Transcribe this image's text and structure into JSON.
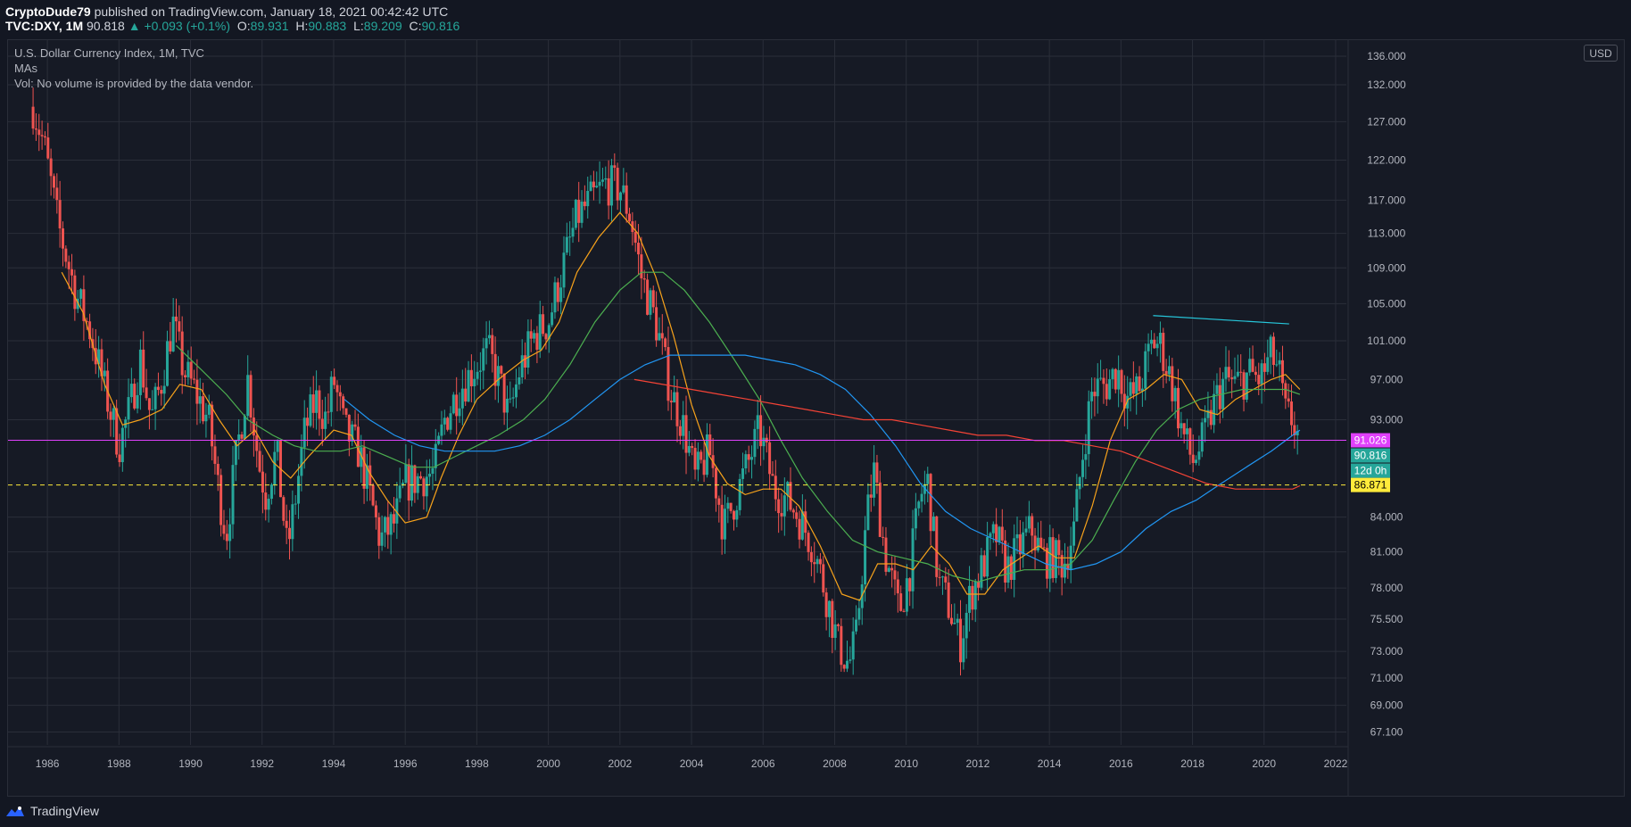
{
  "header": {
    "author": "CryptoDude79",
    "published_text": "published on TradingView.com, January 18, 2021 00:42:42 UTC",
    "symbol": "TVC:DXY, 1M",
    "last": "90.818",
    "change": "▲ +0.093 (+0.1%)",
    "o_label": "O:",
    "o": "89.931",
    "h_label": "H:",
    "h": "90.883",
    "l_label": "L:",
    "l": "89.209",
    "c_label": "C:",
    "c": "90.816"
  },
  "legend": {
    "title": "U.S. Dollar Currency Index, 1M, TVC",
    "mas": "MAs",
    "vol": "Vol: No volume is provided by the data vendor."
  },
  "currency_badge": "USD",
  "footer": {
    "brand": "TradingView"
  },
  "colors": {
    "background": "#161a25",
    "grid": "#2a2e39",
    "up_candle": "#26a69a",
    "down_candle": "#ef5350",
    "ma_orange": "#f7a21b",
    "ma_green": "#4caf50",
    "ma_blue": "#2196f3",
    "ma_red": "#f44336",
    "trendline": "#26c6da",
    "h_line_magenta": "#e040fb",
    "h_line_yellow": "#ffeb3b"
  },
  "chart_data": {
    "type": "candlestick",
    "title": "U.S. Dollar Currency Index, 1M, TVC",
    "currency": "USD",
    "x_ticks": [
      1986,
      1988,
      1990,
      1992,
      1994,
      1996,
      1998,
      2000,
      2002,
      2004,
      2006,
      2008,
      2010,
      2012,
      2014,
      2016,
      2018,
      2020,
      2022
    ],
    "y_ticks": [
      "136.000",
      "132.000",
      "127.000",
      "122.000",
      "117.000",
      "113.000",
      "109.000",
      "105.000",
      "101.000",
      "97.000",
      "93.000",
      "84.000",
      "81.000",
      "78.000",
      "75.500",
      "73.000",
      "71.000",
      "69.000",
      "67.100"
    ],
    "xlim": [
      1984.9,
      2022.3
    ],
    "ylim_log": [
      66.2,
      138.3
    ],
    "price_path": [
      [
        1985.6,
        129.0
      ],
      [
        1985.9,
        124.0
      ],
      [
        1986.3,
        114.0
      ],
      [
        1986.8,
        106.0
      ],
      [
        1987.2,
        102.0
      ],
      [
        1987.6,
        96.0
      ],
      [
        1988.0,
        90.5
      ],
      [
        1988.3,
        94.0
      ],
      [
        1988.6,
        99.0
      ],
      [
        1988.9,
        93.0
      ],
      [
        1989.2,
        97.0
      ],
      [
        1989.5,
        103.0
      ],
      [
        1989.8,
        98.0
      ],
      [
        1990.1,
        96.0
      ],
      [
        1990.5,
        93.0
      ],
      [
        1990.8,
        86.0
      ],
      [
        1991.0,
        82.5
      ],
      [
        1991.3,
        90.0
      ],
      [
        1991.6,
        97.0
      ],
      [
        1991.9,
        89.0
      ],
      [
        1992.1,
        86.0
      ],
      [
        1992.4,
        90.0
      ],
      [
        1992.7,
        81.0
      ],
      [
        1992.9,
        85.0
      ],
      [
        1993.2,
        92.0
      ],
      [
        1993.5,
        95.0
      ],
      [
        1993.8,
        93.0
      ],
      [
        1994.0,
        97.0
      ],
      [
        1994.3,
        92.0
      ],
      [
        1994.7,
        90.0
      ],
      [
        1995.0,
        86.0
      ],
      [
        1995.3,
        82.0
      ],
      [
        1995.7,
        83.5
      ],
      [
        1996.0,
        87.0
      ],
      [
        1996.4,
        87.5
      ],
      [
        1996.8,
        88.0
      ],
      [
        1997.1,
        93.0
      ],
      [
        1997.5,
        96.0
      ],
      [
        1997.9,
        98.0
      ],
      [
        1998.3,
        100.0
      ],
      [
        1998.7,
        96.0
      ],
      [
        1998.9,
        93.0
      ],
      [
        1999.2,
        98.0
      ],
      [
        1999.6,
        101.5
      ],
      [
        2000.0,
        103.0
      ],
      [
        2000.4,
        109.0
      ],
      [
        2000.8,
        115.0
      ],
      [
        2001.2,
        117.0
      ],
      [
        2001.6,
        119.0
      ],
      [
        2002.0,
        118.5
      ],
      [
        2002.3,
        115.0
      ],
      [
        2002.6,
        108.0
      ],
      [
        2003.0,
        103.0
      ],
      [
        2003.4,
        96.0
      ],
      [
        2003.8,
        92.0
      ],
      [
        2004.1,
        87.5
      ],
      [
        2004.5,
        90.0
      ],
      [
        2004.9,
        83.0
      ],
      [
        2005.2,
        85.5
      ],
      [
        2005.6,
        89.0
      ],
      [
        2005.9,
        92.0
      ],
      [
        2006.3,
        86.5
      ],
      [
        2006.7,
        85.5
      ],
      [
        2007.0,
        84.0
      ],
      [
        2007.4,
        81.5
      ],
      [
        2007.8,
        77.0
      ],
      [
        2008.1,
        73.5
      ],
      [
        2008.4,
        72.0
      ],
      [
        2008.6,
        74.0
      ],
      [
        2008.9,
        84.0
      ],
      [
        2009.1,
        88.0
      ],
      [
        2009.4,
        81.0
      ],
      [
        2009.8,
        76.0
      ],
      [
        2010.1,
        79.5
      ],
      [
        2010.4,
        86.0
      ],
      [
        2010.6,
        87.0
      ],
      [
        2010.9,
        78.5
      ],
      [
        2011.2,
        76.5
      ],
      [
        2011.5,
        73.5
      ],
      [
        2011.8,
        77.5
      ],
      [
        2012.1,
        79.5
      ],
      [
        2012.5,
        82.5
      ],
      [
        2012.8,
        79.5
      ],
      [
        2013.1,
        81.0
      ],
      [
        2013.5,
        83.0
      ],
      [
        2013.8,
        80.5
      ],
      [
        2014.1,
        80.5
      ],
      [
        2014.4,
        80.0
      ],
      [
        2014.7,
        83.0
      ],
      [
        2014.9,
        89.0
      ],
      [
        2015.2,
        96.0
      ],
      [
        2015.6,
        96.5
      ],
      [
        2015.9,
        98.0
      ],
      [
        2016.2,
        95.0
      ],
      [
        2016.5,
        96.0
      ],
      [
        2016.9,
        101.0
      ],
      [
        2017.1,
        100.5
      ],
      [
        2017.4,
        97.0
      ],
      [
        2017.7,
        92.0
      ],
      [
        2018.0,
        89.0
      ],
      [
        2018.3,
        91.0
      ],
      [
        2018.6,
        94.5
      ],
      [
        2018.9,
        97.0
      ],
      [
        2019.2,
        96.5
      ],
      [
        2019.6,
        97.5
      ],
      [
        2019.9,
        97.0
      ],
      [
        2020.2,
        99.5
      ],
      [
        2020.4,
        98.0
      ],
      [
        2020.6,
        93.5
      ],
      [
        2020.8,
        93.0
      ],
      [
        2021.0,
        90.8
      ]
    ],
    "ma_orange": [
      [
        1986.4,
        108.5
      ],
      [
        1987.0,
        104.0
      ],
      [
        1987.6,
        96.5
      ],
      [
        1988.1,
        92.5
      ],
      [
        1988.6,
        93.0
      ],
      [
        1989.2,
        94.0
      ],
      [
        1989.7,
        96.5
      ],
      [
        1990.3,
        96.0
      ],
      [
        1990.8,
        93.0
      ],
      [
        1991.3,
        90.5
      ],
      [
        1991.8,
        92.0
      ],
      [
        1992.3,
        89.0
      ],
      [
        1992.8,
        87.5
      ],
      [
        1993.3,
        89.5
      ],
      [
        1994.0,
        92.0
      ],
      [
        1994.5,
        91.5
      ],
      [
        1995.0,
        88.0
      ],
      [
        1995.5,
        85.5
      ],
      [
        1996.0,
        83.5
      ],
      [
        1996.6,
        84.0
      ],
      [
        1997.0,
        87.5
      ],
      [
        1997.5,
        91.5
      ],
      [
        1998.0,
        95.0
      ],
      [
        1998.6,
        97.0
      ],
      [
        1999.3,
        99.0
      ],
      [
        1999.8,
        100.0
      ],
      [
        2000.3,
        103.0
      ],
      [
        2000.8,
        108.5
      ],
      [
        2001.4,
        112.5
      ],
      [
        2002.0,
        115.5
      ],
      [
        2002.5,
        113.0
      ],
      [
        2003.0,
        108.0
      ],
      [
        2003.5,
        101.5
      ],
      [
        2004.0,
        94.5
      ],
      [
        2004.5,
        89.5
      ],
      [
        2005.0,
        87.0
      ],
      [
        2005.5,
        86.0
      ],
      [
        2006.0,
        86.5
      ],
      [
        2006.5,
        86.5
      ],
      [
        2007.0,
        85.0
      ],
      [
        2007.6,
        81.5
      ],
      [
        2008.2,
        77.5
      ],
      [
        2008.7,
        77.0
      ],
      [
        2009.2,
        80.0
      ],
      [
        2009.7,
        80.0
      ],
      [
        2010.2,
        79.5
      ],
      [
        2010.7,
        81.5
      ],
      [
        2011.2,
        80.0
      ],
      [
        2011.7,
        77.5
      ],
      [
        2012.2,
        77.5
      ],
      [
        2012.7,
        79.5
      ],
      [
        2013.2,
        80.5
      ],
      [
        2013.7,
        81.5
      ],
      [
        2014.2,
        80.5
      ],
      [
        2014.7,
        80.5
      ],
      [
        2015.2,
        85.0
      ],
      [
        2015.7,
        91.0
      ],
      [
        2016.2,
        95.0
      ],
      [
        2016.7,
        96.0
      ],
      [
        2017.2,
        97.5
      ],
      [
        2017.7,
        97.0
      ],
      [
        2018.2,
        94.0
      ],
      [
        2018.7,
        93.5
      ],
      [
        2019.2,
        95.0
      ],
      [
        2019.7,
        96.0
      ],
      [
        2020.2,
        97.0
      ],
      [
        2020.6,
        97.5
      ],
      [
        2021.0,
        96.0
      ]
    ],
    "ma_green": [
      [
        1989.6,
        100.5
      ],
      [
        1990.3,
        98.0
      ],
      [
        1991.0,
        95.5
      ],
      [
        1991.6,
        93.0
      ],
      [
        1992.3,
        91.5
      ],
      [
        1992.9,
        90.5
      ],
      [
        1993.5,
        90.0
      ],
      [
        1994.2,
        90.0
      ],
      [
        1994.8,
        90.5
      ],
      [
        1995.5,
        89.5
      ],
      [
        1996.2,
        88.5
      ],
      [
        1996.8,
        88.5
      ],
      [
        1997.4,
        89.5
      ],
      [
        1998.0,
        90.5
      ],
      [
        1998.6,
        91.5
      ],
      [
        1999.3,
        93.0
      ],
      [
        1999.9,
        95.0
      ],
      [
        2000.6,
        98.5
      ],
      [
        2001.3,
        103.0
      ],
      [
        2002.0,
        106.5
      ],
      [
        2002.6,
        108.5
      ],
      [
        2003.2,
        108.5
      ],
      [
        2003.8,
        106.5
      ],
      [
        2004.5,
        103.0
      ],
      [
        2005.2,
        99.0
      ],
      [
        2005.9,
        95.0
      ],
      [
        2006.5,
        91.0
      ],
      [
        2007.1,
        87.5
      ],
      [
        2007.8,
        84.5
      ],
      [
        2008.5,
        82.0
      ],
      [
        2009.2,
        81.0
      ],
      [
        2009.9,
        80.5
      ],
      [
        2010.6,
        80.0
      ],
      [
        2011.3,
        79.0
      ],
      [
        2012.0,
        78.5
      ],
      [
        2012.6,
        79.0
      ],
      [
        2013.3,
        79.5
      ],
      [
        2014.0,
        79.5
      ],
      [
        2014.6,
        80.0
      ],
      [
        2015.2,
        82.0
      ],
      [
        2015.8,
        85.5
      ],
      [
        2016.4,
        89.0
      ],
      [
        2017.0,
        92.0
      ],
      [
        2017.6,
        94.0
      ],
      [
        2018.2,
        95.0
      ],
      [
        2018.8,
        95.5
      ],
      [
        2019.4,
        96.0
      ],
      [
        2020.0,
        96.0
      ],
      [
        2020.6,
        96.0
      ],
      [
        2021.0,
        95.5
      ]
    ],
    "ma_blue": [
      [
        1994.3,
        95.0
      ],
      [
        1995.0,
        93.0
      ],
      [
        1995.7,
        91.5
      ],
      [
        1996.4,
        90.5
      ],
      [
        1997.1,
        90.0
      ],
      [
        1997.8,
        90.0
      ],
      [
        1998.5,
        90.0
      ],
      [
        1999.2,
        90.5
      ],
      [
        1999.9,
        91.5
      ],
      [
        2000.6,
        93.0
      ],
      [
        2001.3,
        95.0
      ],
      [
        2002.0,
        97.0
      ],
      [
        2002.7,
        98.5
      ],
      [
        2003.4,
        99.5
      ],
      [
        2004.1,
        99.5
      ],
      [
        2004.8,
        99.5
      ],
      [
        2005.5,
        99.5
      ],
      [
        2006.2,
        99.0
      ],
      [
        2006.9,
        98.5
      ],
      [
        2007.6,
        97.5
      ],
      [
        2008.3,
        96.0
      ],
      [
        2009.0,
        93.5
      ],
      [
        2009.7,
        90.5
      ],
      [
        2010.4,
        87.0
      ],
      [
        2011.1,
        84.5
      ],
      [
        2011.8,
        83.0
      ],
      [
        2012.5,
        82.0
      ],
      [
        2013.2,
        81.0
      ],
      [
        2013.9,
        80.0
      ],
      [
        2014.6,
        79.5
      ],
      [
        2015.3,
        80.0
      ],
      [
        2016.0,
        81.0
      ],
      [
        2016.7,
        83.0
      ],
      [
        2017.4,
        84.5
      ],
      [
        2018.1,
        85.5
      ],
      [
        2018.8,
        87.0
      ],
      [
        2019.5,
        88.5
      ],
      [
        2020.2,
        90.0
      ],
      [
        2020.8,
        91.5
      ],
      [
        2021.0,
        92.0
      ]
    ],
    "ma_red": [
      [
        2002.4,
        97.0
      ],
      [
        2003.2,
        96.5
      ],
      [
        2004.0,
        96.0
      ],
      [
        2004.8,
        95.5
      ],
      [
        2005.6,
        95.0
      ],
      [
        2006.4,
        94.5
      ],
      [
        2007.2,
        94.0
      ],
      [
        2008.0,
        93.5
      ],
      [
        2008.8,
        93.0
      ],
      [
        2009.6,
        93.0
      ],
      [
        2010.4,
        92.5
      ],
      [
        2011.2,
        92.0
      ],
      [
        2012.0,
        91.5
      ],
      [
        2012.8,
        91.5
      ],
      [
        2013.6,
        91.0
      ],
      [
        2014.4,
        91.0
      ],
      [
        2015.2,
        90.5
      ],
      [
        2016.0,
        90.0
      ],
      [
        2016.8,
        89.0
      ],
      [
        2017.6,
        88.0
      ],
      [
        2018.4,
        87.0
      ],
      [
        2019.2,
        86.5
      ],
      [
        2020.0,
        86.5
      ],
      [
        2020.8,
        86.5
      ],
      [
        2021.0,
        86.8
      ]
    ],
    "trendline": [
      [
        2016.9,
        103.7
      ],
      [
        2020.7,
        102.8
      ]
    ],
    "hlines": [
      {
        "price": 91.026,
        "label": "91.026",
        "color": "#e040fb",
        "style": "solid"
      },
      {
        "price": 86.871,
        "label": "86.871",
        "color": "#ffeb3b",
        "style": "dashed"
      }
    ],
    "price_labels": [
      {
        "price": 91.026,
        "text": "91.026",
        "bg": "#e040fb",
        "fg": "#ffffff"
      },
      {
        "price": 90.816,
        "text": "90.816",
        "bg": "#26a69a",
        "fg": "#ffffff"
      },
      {
        "price": 88.9,
        "text": "12d 0h",
        "bg": "#26a69a",
        "fg": "#ffffff"
      },
      {
        "price": 86.871,
        "text": "86.871",
        "bg": "#ffeb3b",
        "fg": "#000000"
      }
    ]
  }
}
